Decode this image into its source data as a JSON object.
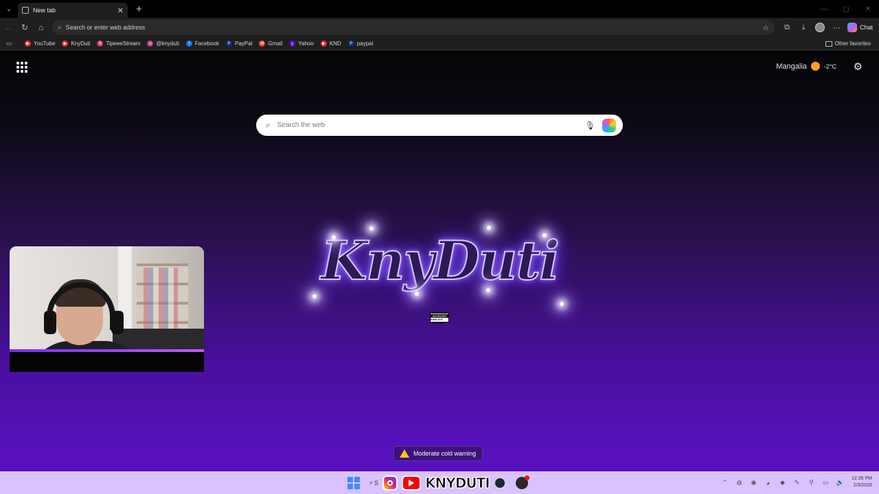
{
  "browser": {
    "tab": {
      "title": "New tab"
    },
    "address": {
      "placeholder": "Search or enter web address"
    },
    "chat_label": "Chat",
    "favorites": [
      {
        "label": "YouTube",
        "color": "#e52d27"
      },
      {
        "label": "KnyDuti",
        "color": "#e52d27"
      },
      {
        "label": "TipeeeStream",
        "color": "#d6336c"
      },
      {
        "label": "@knyduti",
        "color": "#c13584"
      },
      {
        "label": "Facebook",
        "color": "#1877f2"
      },
      {
        "label": "PayPal",
        "color": "#003087"
      },
      {
        "label": "Gmail",
        "color": "#ea4335"
      },
      {
        "label": "Yahoo",
        "color": "#6001d2"
      },
      {
        "label": "KND",
        "color": "#e52d27"
      },
      {
        "label": "paypal",
        "color": "#003087"
      }
    ],
    "other_favorites": "Other favorites"
  },
  "newtab": {
    "weather": {
      "location": "Mangalia",
      "temp": "-2°C"
    },
    "search": {
      "placeholder": "Search the web"
    },
    "logo_text": "KnyDuti",
    "advisory": {
      "line1": "PARENTAL",
      "line2": "ADVISORY",
      "line3": "EXPLICIT CONTENT"
    },
    "warning": "Moderate cold warning"
  },
  "taskbar": {
    "search_label": "S",
    "brand": "KNYDUTI",
    "time": "12:35 PM",
    "date": "2/3/2026"
  }
}
